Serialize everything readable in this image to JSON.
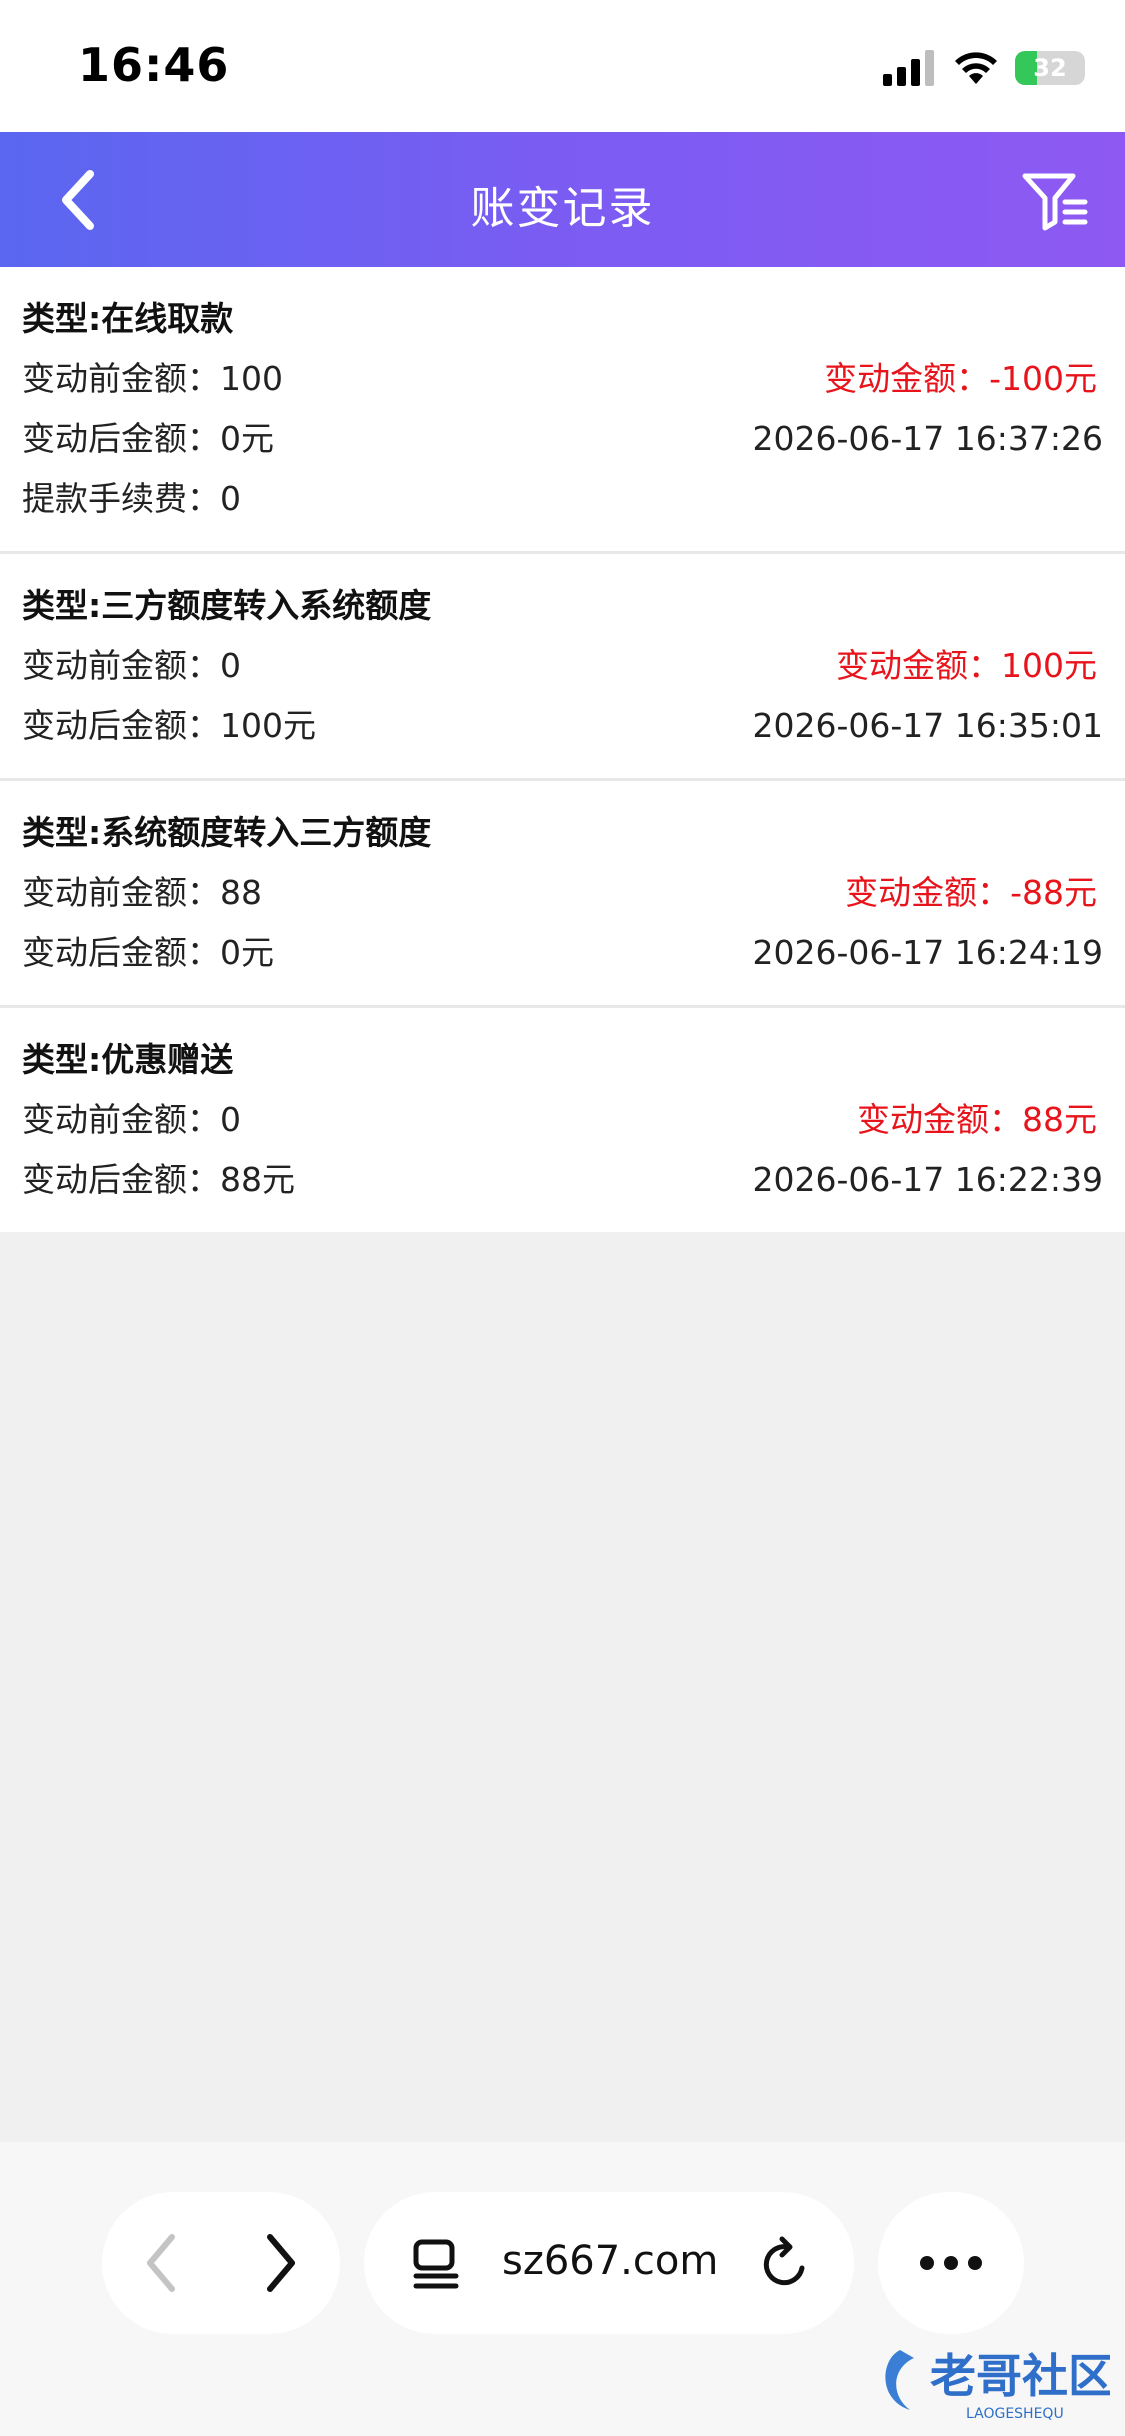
{
  "status_bar": {
    "time": "16:46",
    "battery_level": "32",
    "battery_fraction": 0.32,
    "battery_color": "#34c759"
  },
  "header": {
    "title": "账变记录",
    "back_icon": "chevron-left-icon",
    "filter_icon": "filter-icon",
    "gradient_start": "#5a67f0",
    "gradient_end": "#8e59f3"
  },
  "records": [
    {
      "type": "类型:在线取款",
      "before": "变动前金额：100",
      "change": "变动金额：-100元",
      "after": "变动后金额：0元",
      "time": "2026-06-17 16:37:26",
      "fee": "提款手续费：0"
    },
    {
      "type": "类型:三方额度转入系统额度",
      "before": "变动前金额：0",
      "change": "变动金额：100元",
      "after": "变动后金额：100元",
      "time": "2026-06-17 16:35:01"
    },
    {
      "type": "类型:系统额度转入三方额度",
      "before": "变动前金额：88",
      "change": "变动金额：-88元",
      "after": "变动后金额：0元",
      "time": "2026-06-17 16:24:19"
    },
    {
      "type": "类型:优惠赠送",
      "before": "变动前金额：0",
      "change": "变动金额：88元",
      "after": "变动后金额：88元",
      "time": "2026-06-17 16:22:39"
    }
  ],
  "amount_color": "#e8141b",
  "browser": {
    "url": "sz667.com",
    "back_icon": "chevron-left-icon",
    "forward_icon": "chevron-right-icon",
    "tabs_icon": "tabs-icon",
    "reload_icon": "reload-icon",
    "more_icon": "more-icon"
  },
  "watermark": {
    "text": "老哥社区",
    "subtext": "LAOGESHEQU"
  }
}
